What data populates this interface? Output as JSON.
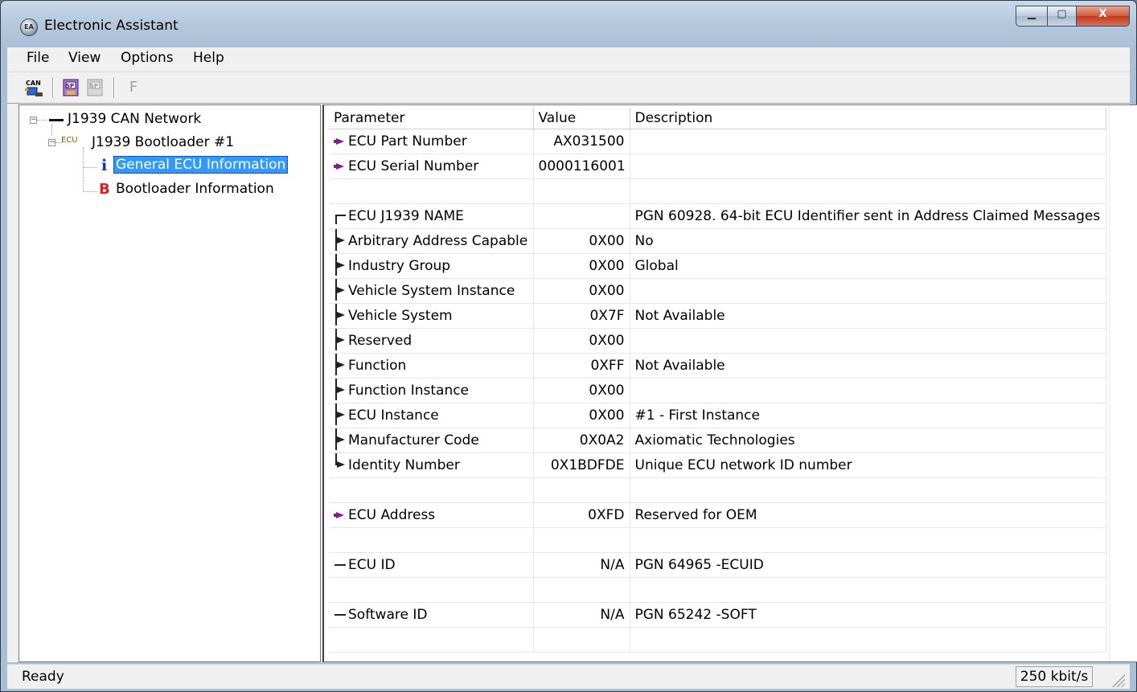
{
  "window": {
    "title": "Electronic Assistant",
    "app_icon_text": "EA",
    "minimize_glyph": "▁",
    "maximize_glyph": "▢",
    "close_glyph": "X"
  },
  "menu": [
    "File",
    "View",
    "Options",
    "Help"
  ],
  "toolbar": {
    "can_icon_text": "CAN",
    "sp_icon_text": "SP",
    "sp_disabled_icon_text": "SP",
    "f_button_text": "F"
  },
  "tree": {
    "root": {
      "label": "J1939 CAN Network",
      "expander": "−"
    },
    "ecu": {
      "label": "J1939 Bootloader #1",
      "prefix": "ECU",
      "expander": "−"
    },
    "items": [
      {
        "label": "General ECU Information",
        "icon_glyph": "i",
        "icon_color": "#1a28c8"
      },
      {
        "label": "Bootloader Information",
        "icon_glyph": "B",
        "icon_color": "#e02020"
      }
    ]
  },
  "grid": {
    "columns": {
      "parameter": "Parameter",
      "value": "Value",
      "description": "Description"
    },
    "rows": [
      {
        "icon": "purple",
        "parameter": "ECU Part Number",
        "value": "AX031500",
        "description": ""
      },
      {
        "icon": "purple",
        "parameter": "ECU Serial Number",
        "value": "0000116001",
        "description": ""
      },
      {
        "icon": "",
        "parameter": "",
        "value": "",
        "description": ""
      },
      {
        "icon": "top",
        "parameter": "ECU J1939 NAME",
        "value": "",
        "description": "PGN 60928. 64-bit ECU Identifier sent in Address Claimed Messages"
      },
      {
        "icon": "mid",
        "parameter": "Arbitrary Address Capable",
        "value": "0X00",
        "description": "No"
      },
      {
        "icon": "mid",
        "parameter": "Industry Group",
        "value": "0X00",
        "description": "Global"
      },
      {
        "icon": "mid",
        "parameter": "Vehicle System Instance",
        "value": "0X00",
        "description": ""
      },
      {
        "icon": "mid",
        "parameter": "Vehicle System",
        "value": "0X7F",
        "description": "Not Available"
      },
      {
        "icon": "mid",
        "parameter": "Reserved",
        "value": "0X00",
        "description": ""
      },
      {
        "icon": "mid",
        "parameter": "Function",
        "value": "0XFF",
        "description": "Not Available"
      },
      {
        "icon": "mid",
        "parameter": "Function Instance",
        "value": "0X00",
        "description": ""
      },
      {
        "icon": "mid",
        "parameter": "ECU Instance",
        "value": "0X00",
        "description": "#1 - First Instance"
      },
      {
        "icon": "mid",
        "parameter": "Manufacturer Code",
        "value": "0X0A2",
        "description": "Axiomatic Technologies"
      },
      {
        "icon": "last",
        "parameter": "Identity Number",
        "value": "0X1BDFDE",
        "description": "Unique ECU network ID number"
      },
      {
        "icon": "",
        "parameter": "",
        "value": "",
        "description": ""
      },
      {
        "icon": "purple",
        "parameter": "ECU Address",
        "value": "0XFD",
        "description": "Reserved for OEM"
      },
      {
        "icon": "",
        "parameter": "",
        "value": "",
        "description": ""
      },
      {
        "icon": "dash",
        "parameter": "ECU ID",
        "value": "N/A",
        "description": "PGN 64965   -ECUID"
      },
      {
        "icon": "",
        "parameter": "",
        "value": "",
        "description": ""
      },
      {
        "icon": "dash",
        "parameter": "Software ID",
        "value": "N/A",
        "description": "PGN 65242   -SOFT"
      },
      {
        "icon": "",
        "parameter": "",
        "value": "",
        "description": ""
      }
    ]
  },
  "status": {
    "text": "Ready",
    "bitrate": "250 kbit/s"
  },
  "colors": {
    "selection": "#3399ff",
    "title_gradient_top": "#c9d9ea",
    "close_button": "#c23a1c"
  }
}
